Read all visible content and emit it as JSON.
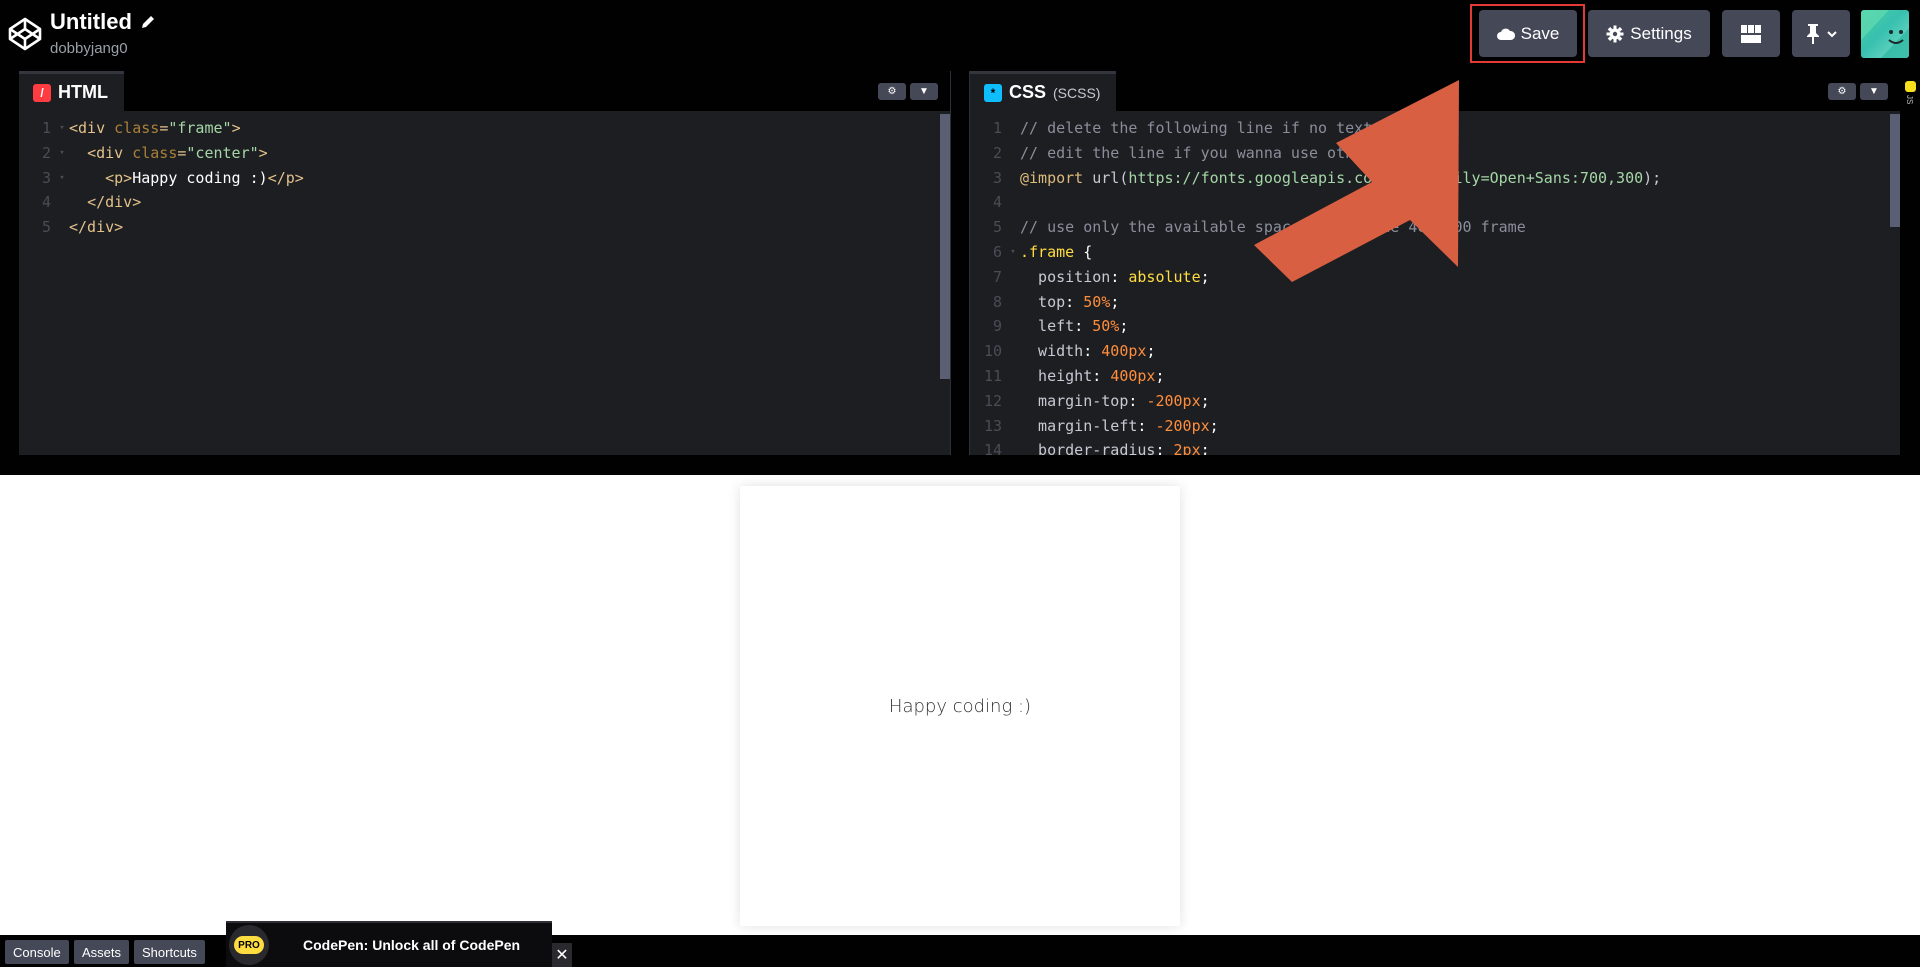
{
  "header": {
    "title": "Untitled",
    "username": "dobbyjang0",
    "save_label": "Save",
    "settings_label": "Settings"
  },
  "html_pane": {
    "tab_label": "HTML",
    "lines": [
      {
        "num": "1",
        "fold": "▾",
        "code": [
          {
            "c": "tg",
            "t": "<div "
          },
          {
            "c": "at",
            "t": "class"
          },
          {
            "c": "tg",
            "t": "="
          },
          {
            "c": "st",
            "t": "\"frame\""
          },
          {
            "c": "tg",
            "t": ">"
          }
        ]
      },
      {
        "num": "2",
        "fold": "▾",
        "code": [
          {
            "c": "tx",
            "t": "  "
          },
          {
            "c": "tg",
            "t": "<div "
          },
          {
            "c": "at",
            "t": "class"
          },
          {
            "c": "tg",
            "t": "="
          },
          {
            "c": "st",
            "t": "\"center\""
          },
          {
            "c": "tg",
            "t": ">"
          }
        ]
      },
      {
        "num": "3",
        "fold": "▾",
        "code": [
          {
            "c": "tx",
            "t": "    "
          },
          {
            "c": "tg",
            "t": "<p>"
          },
          {
            "c": "tx",
            "t": "Happy coding :)"
          },
          {
            "c": "tg",
            "t": "</p>"
          }
        ]
      },
      {
        "num": "4",
        "fold": "",
        "code": [
          {
            "c": "tx",
            "t": "  "
          },
          {
            "c": "tg",
            "t": "</div>"
          }
        ]
      },
      {
        "num": "5",
        "fold": "",
        "code": [
          {
            "c": "tg",
            "t": "</div>"
          }
        ]
      }
    ]
  },
  "css_pane": {
    "tab_label": "CSS",
    "tab_sub": "(SCSS)",
    "lines": [
      {
        "num": "1",
        "fold": "",
        "code": [
          {
            "c": "cm",
            "t": "// delete the following line if no text"
          }
        ]
      },
      {
        "num": "2",
        "fold": "",
        "code": [
          {
            "c": "cm",
            "t": "// edit the line if you wanna use other"
          }
        ]
      },
      {
        "num": "3",
        "fold": "",
        "code": [
          {
            "c": "kw",
            "t": "@import "
          },
          {
            "c": "pr",
            "t": "url("
          },
          {
            "c": "lk",
            "t": "https://fonts.googleapis.com/css?family=Open+Sans:700,300"
          },
          {
            "c": "pr",
            "t": ");"
          }
        ]
      },
      {
        "num": "4",
        "fold": "",
        "code": [
          {
            "c": "tx",
            "t": ""
          }
        ]
      },
      {
        "num": "5",
        "fold": "",
        "code": [
          {
            "c": "cm",
            "t": "// use only the available space inside the 400x400 frame"
          }
        ]
      },
      {
        "num": "6",
        "fold": "▾",
        "code": [
          {
            "c": "sel",
            "t": ".frame "
          },
          {
            "c": "tx",
            "t": "{"
          }
        ]
      },
      {
        "num": "7",
        "fold": "",
        "code": [
          {
            "c": "pr",
            "t": "  position"
          },
          {
            "c": "tx",
            "t": ": "
          },
          {
            "c": "val",
            "t": "absolute"
          },
          {
            "c": "tx",
            "t": ";"
          }
        ]
      },
      {
        "num": "8",
        "fold": "",
        "code": [
          {
            "c": "pr",
            "t": "  top"
          },
          {
            "c": "tx",
            "t": ": "
          },
          {
            "c": "nm",
            "t": "50%"
          },
          {
            "c": "tx",
            "t": ";"
          }
        ]
      },
      {
        "num": "9",
        "fold": "",
        "code": [
          {
            "c": "pr",
            "t": "  left"
          },
          {
            "c": "tx",
            "t": ": "
          },
          {
            "c": "nm",
            "t": "50%"
          },
          {
            "c": "tx",
            "t": ";"
          }
        ]
      },
      {
        "num": "10",
        "fold": "",
        "code": [
          {
            "c": "pr",
            "t": "  width"
          },
          {
            "c": "tx",
            "t": ": "
          },
          {
            "c": "nm",
            "t": "400px"
          },
          {
            "c": "tx",
            "t": ";"
          }
        ]
      },
      {
        "num": "11",
        "fold": "",
        "code": [
          {
            "c": "pr",
            "t": "  height"
          },
          {
            "c": "tx",
            "t": ": "
          },
          {
            "c": "nm",
            "t": "400px"
          },
          {
            "c": "tx",
            "t": ";"
          }
        ]
      },
      {
        "num": "12",
        "fold": "",
        "code": [
          {
            "c": "pr",
            "t": "  margin-top"
          },
          {
            "c": "tx",
            "t": ": "
          },
          {
            "c": "nm",
            "t": "-200px"
          },
          {
            "c": "tx",
            "t": ";"
          }
        ]
      },
      {
        "num": "13",
        "fold": "",
        "code": [
          {
            "c": "pr",
            "t": "  margin-left"
          },
          {
            "c": "tx",
            "t": ": "
          },
          {
            "c": "nm",
            "t": "-200px"
          },
          {
            "c": "tx",
            "t": ";"
          }
        ]
      },
      {
        "num": "14",
        "fold": "",
        "code": [
          {
            "c": "pr",
            "t": "  border-radius"
          },
          {
            "c": "tx",
            "t": ": "
          },
          {
            "c": "nm",
            "t": "2px"
          },
          {
            "c": "tx",
            "t": ";"
          }
        ]
      }
    ]
  },
  "preview": {
    "text": "Happy coding :)"
  },
  "footer": {
    "console_label": "Console",
    "assets_label": "Assets",
    "shortcuts_label": "Shortcuts",
    "promo_badge": "PRO",
    "promo_text": "CodePen: Unlock all of CodePen",
    "close_glyph": "✕"
  },
  "icons": {
    "logo": "codepen-logo-icon",
    "pencil": "pencil-icon",
    "cloud": "cloud-icon",
    "gear": "gear-icon",
    "layout": "layout-grid-icon",
    "pin": "pin-icon",
    "chevron": "chevron-down-icon"
  },
  "colors": {
    "accent_save_outline": "#e53935",
    "arrow": "#d95f43",
    "html_icon": "#ff3c41",
    "css_icon": "#0ebeff",
    "js_icon": "#f7df1e"
  }
}
